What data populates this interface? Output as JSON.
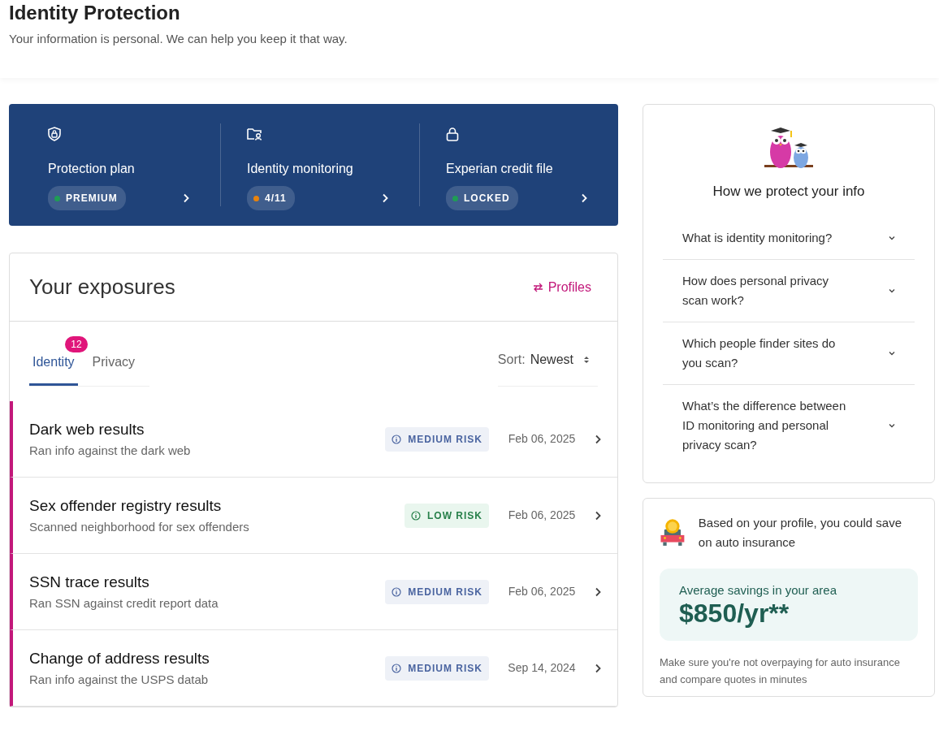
{
  "header": {
    "title": "Identity Protection",
    "subtitle": "Your information is personal. We can help you keep it that way."
  },
  "summary": [
    {
      "label": "Protection plan",
      "status": "PREMIUM",
      "color": "#1f9d55"
    },
    {
      "label": "Identity monitoring",
      "status": "4/11",
      "color": "#e8830c"
    },
    {
      "label": "Experian credit file",
      "status": "LOCKED",
      "color": "#1f9d55"
    }
  ],
  "exposures": {
    "title": "Your exposures",
    "profiles_link": "Profiles",
    "tabs": [
      {
        "label": "Identity",
        "selected": true,
        "badge": "12"
      },
      {
        "label": "Privacy",
        "selected": false
      }
    ],
    "sort": {
      "label": "Sort:",
      "value": "Newest"
    },
    "items": [
      {
        "title": "Dark web results",
        "subtitle": "Ran info against the dark web",
        "kind": "medium",
        "risk_label": "MEDIUM RISK",
        "date": "Feb 06, 2025"
      },
      {
        "title": "Sex offender registry results",
        "subtitle": "Scanned neighborhood for sex offenders",
        "kind": "low",
        "risk_label": "LOW RISK",
        "date": "Feb 06, 2025"
      },
      {
        "title": "SSN trace results",
        "subtitle": "Ran SSN against credit report data",
        "kind": "medium",
        "risk_label": "MEDIUM RISK",
        "date": "Feb 06, 2025"
      },
      {
        "title": "Change of address results",
        "subtitle": "Ran info against the USPS datab",
        "kind": "medium",
        "risk_label": "MEDIUM RISK",
        "date": "Sep 14, 2024"
      }
    ]
  },
  "faq": {
    "title": "How we protect your info",
    "questions": [
      {
        "text": "What is identity monitoring?",
        "expanded": false
      },
      {
        "text": "How does personal privacy scan work?",
        "expanded": false
      },
      {
        "text": "Which people finder sites do you scan?",
        "expanded": false
      },
      {
        "text": "What’s the difference between ID monitoring and personal privacy scan?",
        "expanded": false
      }
    ]
  },
  "insurance": {
    "text": "Based on your profile, you could save on auto insurance",
    "savings_label": "Average savings in your area",
    "savings_value": "$850/yr**",
    "note": "Make sure you're not overpaying for auto insurance and compare quotes in minutes"
  }
}
